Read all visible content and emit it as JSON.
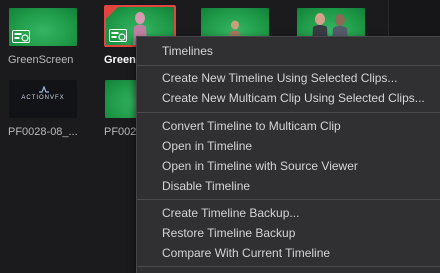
{
  "media_pool": {
    "clips": [
      {
        "name": "GreenScreen"
      },
      {
        "name": "Green"
      },
      {
        "name": ""
      },
      {
        "name": ""
      },
      {
        "name": "PF0028-08_..."
      },
      {
        "name": "PF002"
      },
      {
        "logo_text": "ACTIONVFX"
      }
    ]
  },
  "context_menu": {
    "header": "Timelines",
    "group1": [
      "Create New Timeline Using Selected Clips...",
      "Create New Multicam Clip Using Selected Clips..."
    ],
    "group2": [
      "Convert Timeline to Multicam Clip",
      "Open in Timeline",
      "Open in Timeline with Source Viewer",
      "Disable Timeline"
    ],
    "group3": [
      "Create Timeline Backup...",
      "Restore Timeline Backup",
      "Compare With Current Timeline"
    ]
  },
  "colors": {
    "selection": "#e0453f",
    "chroma_green": "#1f9a48",
    "menu_bg": "#303033"
  }
}
